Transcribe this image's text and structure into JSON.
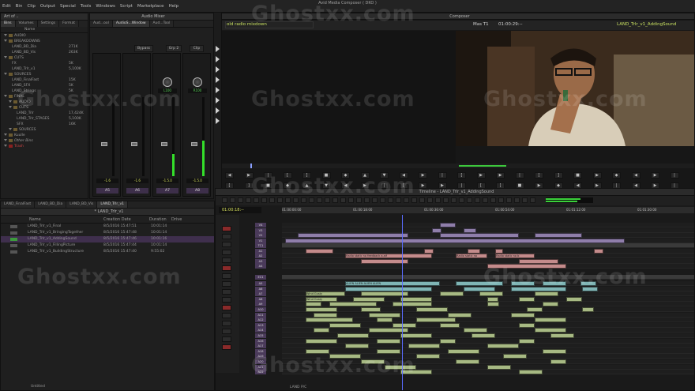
{
  "menu": [
    "Edit",
    "Bin",
    "Clip",
    "Output",
    "Special",
    "Tools",
    "Windows",
    "Script",
    "Marketplace",
    "Help"
  ],
  "app_title": "Avid Media Composer ( DKO )",
  "project": {
    "title": "Art of ..",
    "tabs": [
      "Bins",
      "Volumes",
      "Settings",
      "Format"
    ],
    "column_header": "Name",
    "column_header2": "Transfer",
    "rows": [
      {
        "name": "AUDIO",
        "size": ""
      },
      {
        "name": "BREAKDOWNS",
        "size": ""
      },
      {
        "name": "LAND_BD_Dia",
        "size": "271K"
      },
      {
        "name": "LAND_BD_Vis",
        "size": "263K"
      },
      {
        "name": "CUTS",
        "size": ""
      },
      {
        "name": "FX",
        "size": "5K"
      },
      {
        "name": "LAND_Trlr_v1",
        "size": "5,100K"
      },
      {
        "name": "SOURCES",
        "size": ""
      },
      {
        "name": "LAND_FinalFast",
        "size": "15K"
      },
      {
        "name": "LAND_SFX",
        "size": "5K"
      },
      {
        "name": "LAND_Strings",
        "size": "5K"
      },
      {
        "name": "FINAL",
        "size": ""
      },
      {
        "name": "AUDIO",
        "size": ""
      },
      {
        "name": "CUTS",
        "size": ""
      },
      {
        "name": "LAND_Trlr",
        "size": "17,424K"
      },
      {
        "name": "LAND_Trlr_STAGES",
        "size": "5,100K"
      },
      {
        "name": "SFX",
        "size": "16K"
      },
      {
        "name": "SOURCES",
        "size": ""
      },
      {
        "name": "Kuulle",
        "size": ""
      },
      {
        "name": "Other Bins",
        "size": ""
      },
      {
        "name": "Trash",
        "size": ""
      }
    ]
  },
  "mixer": {
    "title": "Audio Mixer",
    "tabs": [
      "Aud...ool",
      "AudioS...Window",
      "Aud...Tool"
    ],
    "bypass": "Bypass",
    "grp": "Grp 2",
    "clip": "Clip",
    "channels": [
      "A5",
      "A6",
      "A7",
      "A8"
    ],
    "level_labels": [
      "-1.6",
      "-1.6",
      "-1.5.0",
      "-1.5.0"
    ],
    "pan_values": [
      "L100",
      "R100"
    ],
    "meter_levels": [
      0.0,
      0.0,
      0.28,
      0.45
    ]
  },
  "composer": {
    "title": "Composer",
    "source_name": "old radio mixdown",
    "timecode_left": "Mas T1",
    "timecode_mid": "01:00:29:--",
    "sequence_name": "LAND_Trlr_v1_AddingSound"
  },
  "bin": {
    "tabs": [
      "LAND_FinalFast",
      "LAND_BD_Dia",
      "LAND_BD_Vis",
      "LAND_Trlr_v1"
    ],
    "title": "* LAND_Trlr_v1",
    "headers": [
      "Name",
      "Creation Date",
      "Duration",
      "Drive"
    ],
    "rows": [
      {
        "name": "LAND_Trlr_v1_Final",
        "date": "8/5/2016 15:47:51",
        "dur": "10:01:14",
        "sel": false
      },
      {
        "name": "LAND_Trlr_v1_BringingTogether",
        "date": "8/5/2016 15:47:48",
        "dur": "10:01:14",
        "sel": false
      },
      {
        "name": "LAND_Trlr_v1_AddingSound",
        "date": "8/5/2016 15:47:46",
        "dur": "10:01:16",
        "sel": true
      },
      {
        "name": "LAND_Trlr_v1_FillingPicture",
        "date": "8/5/2016 15:47:44",
        "dur": "10:01:14",
        "sel": false
      },
      {
        "name": "LAND_Trlr_v1_BuildingStructure",
        "date": "8/5/2016 15:47:40",
        "dur": "9:55:02",
        "sel": false
      }
    ],
    "footer": "Untitled"
  },
  "timeline": {
    "title": "Timeline - LAND_Trlr_v1_AddingSound",
    "timecode": "01:00:18:--",
    "ruler": [
      "01:00:00:00",
      "01:00:18:00",
      "01:00:36:00",
      "01:00:54:00",
      "01:01:12:00",
      "01:01:30:00"
    ],
    "tracks_top": [
      "V4",
      "V3",
      "V2",
      "V1",
      "TC1",
      "A1",
      "A2",
      "A3",
      "A4"
    ],
    "tracks_mid": [
      "EC1"
    ],
    "tracks_bot": [
      "A5",
      "A6",
      "A7",
      "A8",
      "A9",
      "A10",
      "A11",
      "A12",
      "A13",
      "A14",
      "A15",
      "A16",
      "A17",
      "A18",
      "A19",
      "A20",
      "A21",
      "A22"
    ],
    "clip_labels": [
      "Radio static no feedback a.aif",
      "Radio static no",
      "Radio static no b",
      "ALIEN ALIEN ALIEN ALIEN",
      "Wind Gusty",
      "Wind Gusty"
    ],
    "status": "LAND P/C"
  },
  "watermark": "Ghostxx.com"
}
